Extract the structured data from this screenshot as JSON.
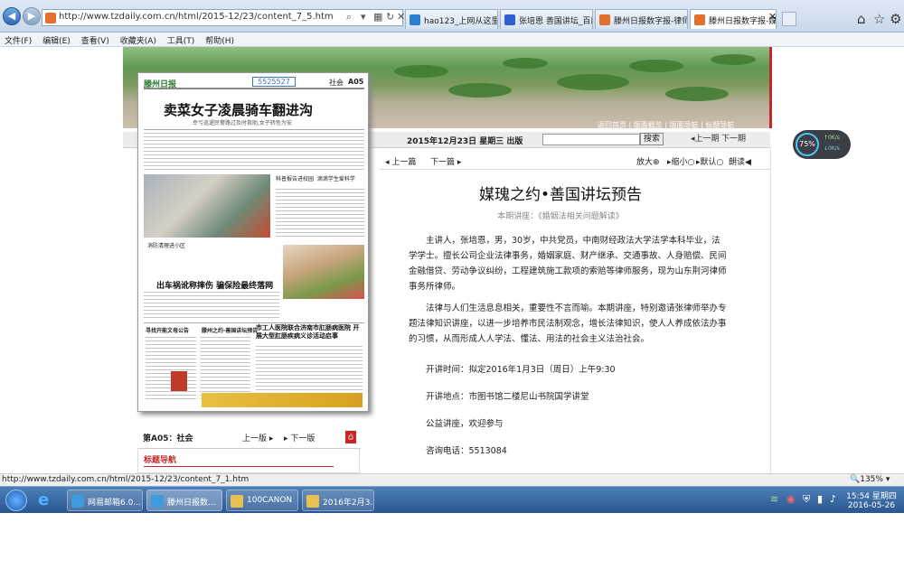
{
  "browser": {
    "url": "http://www.tzdaily.com.cn/html/2015-12/23/content_7_5.htm",
    "tabs": [
      {
        "label": "hao123_上网从这里开..."
      },
      {
        "label": "张培恩 善国讲坛_百度..."
      },
      {
        "label": "滕州日报数字报-律师..."
      },
      {
        "label": "滕州日报数字报-媒..."
      }
    ],
    "menu": [
      "文件(F)",
      "编辑(E)",
      "查看(V)",
      "收藏夹(A)",
      "工具(T)",
      "帮助(H)"
    ]
  },
  "banner": {
    "nav": [
      "返回首页",
      "版面概览",
      "版面导航",
      "标题导航"
    ],
    "date": "2015年12月23日  星期三  出版",
    "search_button": "搜索",
    "prev_page": "上一期",
    "next_page": "下一期"
  },
  "newspaper": {
    "section": "社会",
    "page_no": "A05",
    "phone": "5525527",
    "headline": "卖菜女子凌晨骑车翻进沟",
    "subhead": "幸亏巡逻民警路过及时救助,女子转危为安",
    "headline2": "出车祸讹称摔伤  骗保险最终落网",
    "headline3": "市工人医院联合济南市肛肠病医院 开展大型肛肠疾病义诊活动启事",
    "box1": "科普报告进校园",
    "box2": "滴滴学生爱科学",
    "caption": "消防清理进小区",
    "notice": "寻找开能文母公告",
    "notice2": "滕州之约·善国讲坛预告"
  },
  "pager": {
    "label": "第A05：社会",
    "prev": "上一版",
    "next": "下一版",
    "guide": "标题导航"
  },
  "article": {
    "prev": "上一篇",
    "next": "下一篇",
    "zoom_in": "放大",
    "zoom_out": "缩小",
    "default": "默认",
    "read": "朗读",
    "title": "媒瑰之约•善国讲坛预告",
    "subtitle": "本期讲座：《婚姻法相关问题解读》",
    "p1": "主讲人，张培恩，男，30岁，中共党员，中南财经政法大学法学本科毕业，法学学士。擅长公司企业法律事务，婚姻家庭、财产继承、交通事故、人身赔偿、民间金融借贷、劳动争议纠纷，工程建筑施工款项的索赔等律师服务，现为山东荆河律师事务所律师。",
    "p2": "法律与人们生活息息相关，重要性不言而喻。本期讲座，特别邀请张律师举办专题法律知识讲座，以进一步培养市民法制观念，增长法律知识，使人人养成依法办事的习惯，从而形成人人学法、懂法、用法的社会主义法治社会。",
    "p3": "开讲时间：拟定2016年1月3日（周日）上午9:30",
    "p4": "开讲地点：市图书馆二楼尼山书院国学讲堂",
    "p5": "公益讲座，欢迎参与",
    "p6": "咨询电话：5513084"
  },
  "gauge": {
    "percent": "75%",
    "up": "0K/s",
    "down": "0K/s"
  },
  "status": {
    "url": "http://www.tzdaily.com.cn/html/2015-12/23/content_7_1.htm",
    "zoom": "135%"
  },
  "taskbar": {
    "items": [
      "网易邮箱6.0...",
      "滕州日报数...",
      "100CANON",
      "2016年2月3..."
    ],
    "time": "15:54 星期四",
    "date": "2016-05-26"
  }
}
